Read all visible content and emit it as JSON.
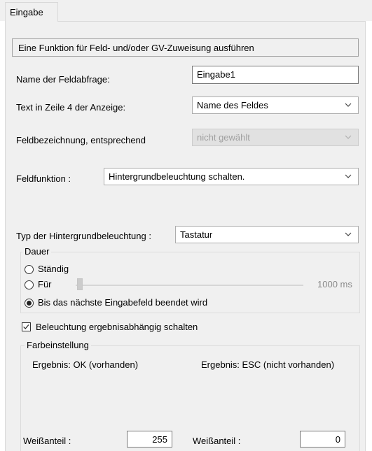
{
  "tabs": [
    {
      "label": "Eingabe",
      "active": true
    }
  ],
  "description": "Eine Funktion für Feld- und/oder GV-Zuweisung ausführen",
  "field_query": {
    "label": "Name der Feldabfrage:",
    "value": "Eingabe1"
  },
  "line4_text": {
    "label": "Text in Zeile 4 der Anzeige:",
    "value": "Name des Feldes"
  },
  "field_designation": {
    "label": "Feldbezeichnung, entsprechend",
    "value": "nicht gewählt",
    "enabled": false
  },
  "field_function": {
    "label": "Feldfunktion :",
    "value": "Hintergrundbeleuchtung schalten."
  },
  "backlight_type": {
    "label": "Typ der Hintergrundbeleuchtung :",
    "value": "Tastatur"
  },
  "duration": {
    "legend": "Dauer",
    "options": [
      {
        "label": "Ständig",
        "selected": false
      },
      {
        "label": "Für",
        "selected": false
      },
      {
        "label": "Bis das nächste Eingabefeld beendet wird",
        "selected": true
      }
    ],
    "slider_value": "1000",
    "slider_unit": "ms",
    "slider_enabled": false
  },
  "result_dependent": {
    "label": "Beleuchtung ergebnisabhängig schalten",
    "checked": true
  },
  "color_settings": {
    "legend": "Farbeinstellung",
    "ok": {
      "header": "Ergebnis: OK (vorhanden)",
      "white_label": "Weißanteil :",
      "white_value": "255"
    },
    "esc": {
      "header": "Ergebnis: ESC (nicht vorhanden)",
      "white_label": "Weißanteil :",
      "white_value": "0"
    }
  },
  "colors": {
    "panel_bg": "#f0f0f0",
    "disabled_text": "#a0a0a0"
  }
}
